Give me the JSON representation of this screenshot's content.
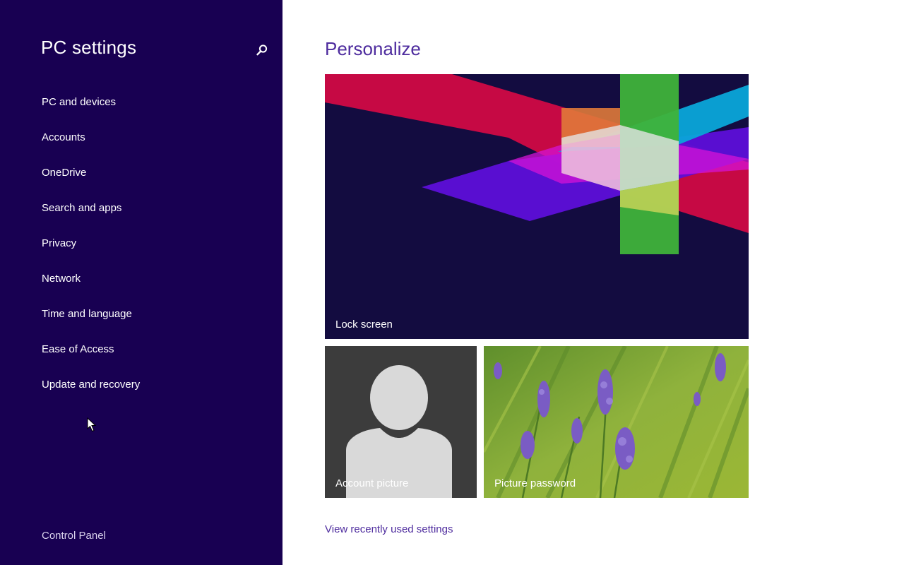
{
  "sidebar": {
    "title": "PC settings",
    "search_icon": "search-icon",
    "items": [
      {
        "label": "PC and devices"
      },
      {
        "label": "Accounts"
      },
      {
        "label": "OneDrive"
      },
      {
        "label": "Search and apps"
      },
      {
        "label": "Privacy"
      },
      {
        "label": "Network"
      },
      {
        "label": "Time and language"
      },
      {
        "label": "Ease of Access"
      },
      {
        "label": "Update and recovery"
      }
    ],
    "control_panel": "Control Panel"
  },
  "main": {
    "title": "Personalize",
    "tiles": {
      "lock_screen": "Lock screen",
      "account_picture": "Account picture",
      "picture_password": "Picture password"
    },
    "recent_link": "View recently used settings"
  },
  "colors": {
    "sidebar_bg": "#180052",
    "accent": "#4e2c9e",
    "main_bg": "#ffffff"
  }
}
